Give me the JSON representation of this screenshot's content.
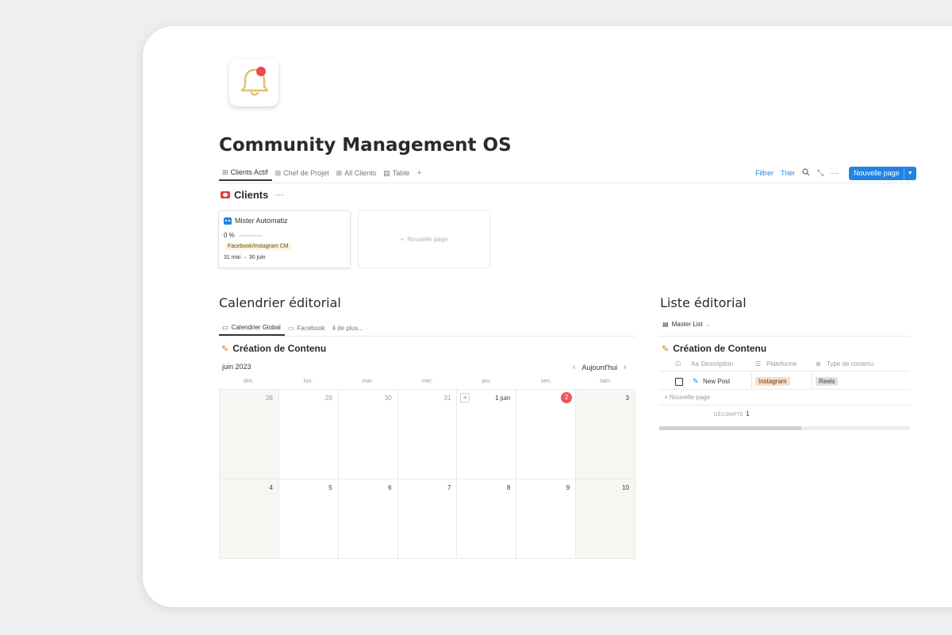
{
  "page": {
    "title": "Community Management OS",
    "icon": "bell-icon"
  },
  "tabs": [
    {
      "label": "Clients Actif",
      "icon": "gallery-icon",
      "active": true
    },
    {
      "label": "Chef de Projet",
      "icon": "gallery-icon"
    },
    {
      "label": "All Clients",
      "icon": "gallery-icon"
    },
    {
      "label": "Table",
      "icon": "table-icon"
    }
  ],
  "toolbar": {
    "filter": "Filtrer",
    "sort": "Trier",
    "new_page": "Nouvelle page"
  },
  "clients": {
    "title": "Clients",
    "more": "···",
    "card": {
      "name": "Mister Automatiz",
      "progress_label": "0 %",
      "progress": 0,
      "tag": "Facebook/Instagram CM",
      "dates": "31 mai → 30 juin"
    },
    "new_card": "Nouvelle page"
  },
  "calendar": {
    "heading": "Calendrier éditorial",
    "tabs": [
      "Calendrier Global",
      "Facebook",
      "4 de plus..."
    ],
    "section_title": "Création de Contenu",
    "month": "juin 2023",
    "today_label": "Aujourd'hui",
    "weekdays": [
      "dim.",
      "lun.",
      "mar.",
      "mer.",
      "jeu.",
      "ven.",
      "sam."
    ],
    "week1": [
      "28",
      "29",
      "30",
      "31",
      "1 juin",
      "2",
      "3"
    ],
    "week2": [
      "4",
      "5",
      "6",
      "7",
      "8",
      "9",
      "10"
    ],
    "today_day": "2"
  },
  "list": {
    "heading": "Liste éditorial",
    "view": "Master List",
    "section_title": "Création de Contenu",
    "columns": [
      "Aa",
      "Description",
      "Plateforme",
      "Type de contenu"
    ],
    "rows": [
      {
        "title": "New Post",
        "platform": "Instagram",
        "type": "Reels"
      }
    ],
    "new_row": "Nouvelle page",
    "count_label": "DÉCOMPTE",
    "count": "1"
  },
  "colors": {
    "accent": "#2383e2",
    "today": "#eb5757",
    "bell": "#e8c77a"
  }
}
